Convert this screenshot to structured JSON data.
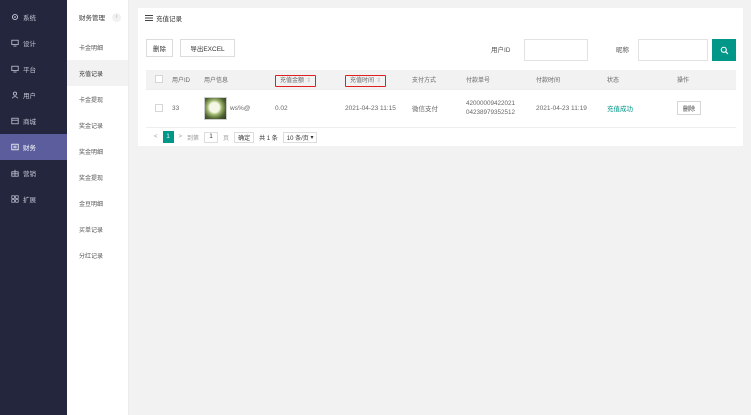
{
  "nav": {
    "items": [
      {
        "label": "系统",
        "icon": "gear-icon"
      },
      {
        "label": "设计",
        "icon": "monitor-icon"
      },
      {
        "label": "平台",
        "icon": "monitor-icon"
      },
      {
        "label": "用户",
        "icon": "user-icon"
      },
      {
        "label": "商城",
        "icon": "shop-icon"
      },
      {
        "label": "财务",
        "icon": "finance-icon"
      },
      {
        "label": "营销",
        "icon": "marketing-icon"
      },
      {
        "label": "扩展",
        "icon": "grid-icon"
      }
    ]
  },
  "submenu": {
    "title": "财务管理",
    "collapse_icon": "chevron-left-icon",
    "items": [
      "卡金明细",
      "充值记录",
      "卡金提现",
      "奖金记录",
      "奖金明细",
      "奖金提现",
      "金豆明细",
      "买单记录",
      "分红记录"
    ]
  },
  "panel": {
    "title": "充值记录",
    "delete_label": "删除",
    "export_label": "导出EXCEL",
    "user_id_label": "用户ID",
    "nickname_label": "昵称"
  },
  "table": {
    "headers": [
      "用户ID",
      "用户信息",
      "充值金额",
      "充值时间",
      "支付方式",
      "付款单号",
      "付款时间",
      "状态",
      "操作"
    ],
    "sort_icon": "sort-icon",
    "rows": [
      {
        "user_id": "33",
        "nickname": "ws%@",
        "amount": "0.02",
        "time": "2021-04-23 11:15",
        "pay_method": "微信支付",
        "order_no_1": "42000009422021",
        "order_no_2": "04238979352512",
        "pay_time": "2021-04-23 11:19",
        "status": "充值成功",
        "action": "删除"
      }
    ]
  },
  "pager": {
    "prev": "<",
    "current": "1",
    "next": ">",
    "goto_label": "到第",
    "page_input": "1",
    "page_unit": "页",
    "confirm": "确定",
    "total": "共 1 条",
    "page_size": "10 条/页"
  },
  "colors": {
    "accent": "#009688",
    "sidebar": "#23263c",
    "active_nav": "#5b5d9c",
    "highlight": "#e02020"
  }
}
